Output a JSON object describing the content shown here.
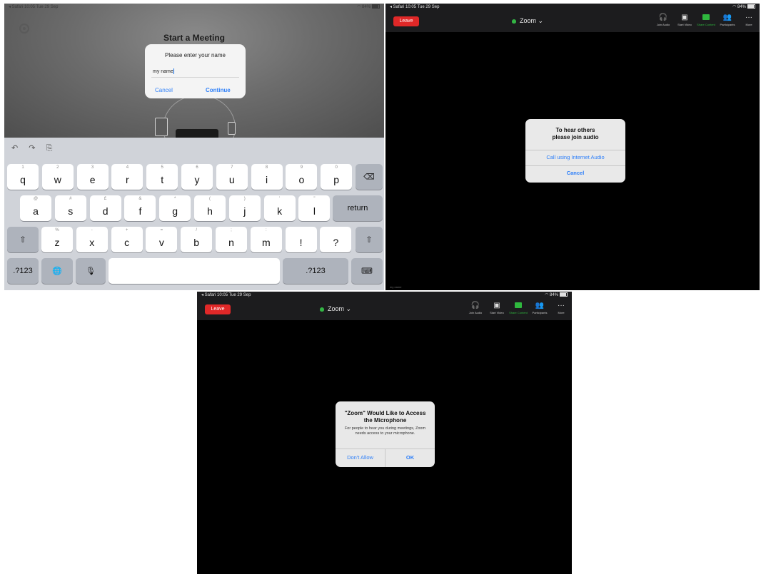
{
  "status": {
    "back_app": "◂ Safari",
    "time": "10:05",
    "date": "Tue 29 Sep",
    "battery": "84%"
  },
  "start_meeting": {
    "title": "Start a Meeting",
    "dialog": {
      "title": "Please enter your name",
      "input_value": "my name",
      "cancel": "Cancel",
      "continue": "Continue"
    }
  },
  "keyboard": {
    "toolbar": [
      "↶",
      "↷",
      "⎘"
    ],
    "row1": [
      {
        "sec": "1",
        "key": "q"
      },
      {
        "sec": "2",
        "key": "w"
      },
      {
        "sec": "3",
        "key": "e"
      },
      {
        "sec": "4",
        "key": "r"
      },
      {
        "sec": "5",
        "key": "t"
      },
      {
        "sec": "6",
        "key": "y"
      },
      {
        "sec": "7",
        "key": "u"
      },
      {
        "sec": "8",
        "key": "i"
      },
      {
        "sec": "9",
        "key": "o"
      },
      {
        "sec": "0",
        "key": "p"
      }
    ],
    "row2": [
      {
        "sec": "@",
        "key": "a"
      },
      {
        "sec": "#",
        "key": "s"
      },
      {
        "sec": "£",
        "key": "d"
      },
      {
        "sec": "&",
        "key": "f"
      },
      {
        "sec": "*",
        "key": "g"
      },
      {
        "sec": "(",
        "key": "h"
      },
      {
        "sec": ")",
        "key": "j"
      },
      {
        "sec": "'",
        "key": "k"
      },
      {
        "sec": "\"",
        "key": "l"
      }
    ],
    "row3": [
      {
        "sec": "%",
        "key": "z"
      },
      {
        "sec": "-",
        "key": "x"
      },
      {
        "sec": "+",
        "key": "c"
      },
      {
        "sec": "=",
        "key": "v"
      },
      {
        "sec": "/",
        "key": "b"
      },
      {
        "sec": ";",
        "key": "n"
      },
      {
        "sec": ":",
        "key": "m"
      },
      {
        "sec": "",
        "key": "!"
      },
      {
        "sec": "",
        "key": "?"
      }
    ],
    "backspace": "⌫",
    "return": "return",
    "shift": "⇧",
    "numbers": ".?123",
    "globe": "🌐",
    "mic": "🎙",
    "hide": "⌨"
  },
  "zoom_bar": {
    "leave": "Leave",
    "title": "Zoom",
    "chevron": "⌄",
    "tools": [
      {
        "icon": "headphones-icon",
        "glyph": "🎧",
        "label": "Join Audio"
      },
      {
        "icon": "video-off-icon",
        "glyph": "▣",
        "label": "Start Video"
      },
      {
        "icon": "share-screen-icon",
        "glyph": "↑",
        "label": "Share Content"
      },
      {
        "icon": "participants-icon",
        "glyph": "👥",
        "label": "Participants"
      },
      {
        "icon": "more-icon",
        "glyph": "···",
        "label": "More"
      }
    ]
  },
  "audio_dialog": {
    "title_line1": "To hear others",
    "title_line2": "please join audio",
    "option": "Call using Internet Audio",
    "cancel": "Cancel"
  },
  "participant_name": "my name",
  "mic_dialog": {
    "title_line1": "\"Zoom\" Would Like to Access",
    "title_line2": "the Microphone",
    "body": "For people to hear you during meetings, Zoom needs access to your microphone.",
    "deny": "Don't Allow",
    "ok": "OK"
  },
  "colors": {
    "leave_red": "#e02828",
    "share_green": "#2fb83e",
    "link_blue": "#2d7ff9"
  }
}
